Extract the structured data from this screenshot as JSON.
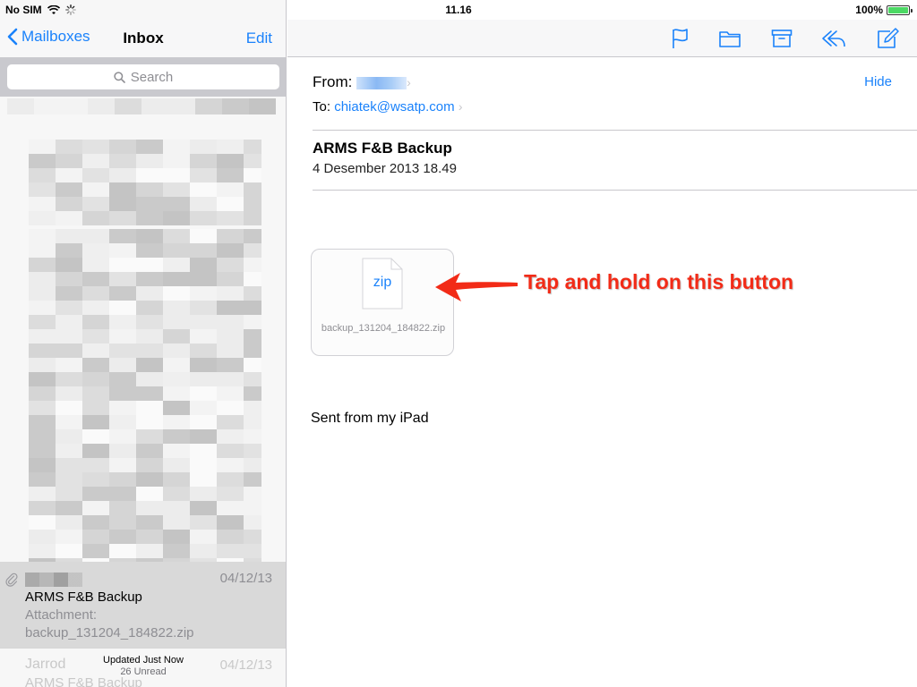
{
  "status_bar": {
    "carrier": "No SIM",
    "time": "11.16",
    "battery_percent": "100%",
    "battery_level": 1.0
  },
  "left_nav": {
    "back_label": "Mailboxes",
    "title": "Inbox",
    "edit_label": "Edit"
  },
  "search": {
    "placeholder": "Search"
  },
  "selected_message": {
    "date": "04/12/13",
    "subject": "ARMS F&B Backup",
    "preview_line1": "Attachment:",
    "preview_line2": "backup_131204_184822.zip"
  },
  "ghost_message": {
    "sender": "Jarrod",
    "date": "04/12/13",
    "subject": "ARMS F&B Backup"
  },
  "list_footer": {
    "updated": "Updated Just Now",
    "unread": "26 Unread"
  },
  "message": {
    "from_label": "From:",
    "to_label": "To:",
    "to_address": "chiatek@wsatp.com",
    "hide_label": "Hide",
    "subject": "ARMS F&B Backup",
    "date": "4 Desember 2013 18.49",
    "attachment": {
      "type_label": "zip",
      "filename": "backup_131204_184822.zip"
    },
    "signature": "Sent from my iPad"
  },
  "annotation": {
    "text": "Tap and hold on this button",
    "color": "#f22b17"
  },
  "colors": {
    "accent": "#1a82fb",
    "separator": "#c8c7cc"
  },
  "toolbar_icons": [
    "flag-icon",
    "folder-icon",
    "archive-icon",
    "reply-icon",
    "compose-icon"
  ]
}
